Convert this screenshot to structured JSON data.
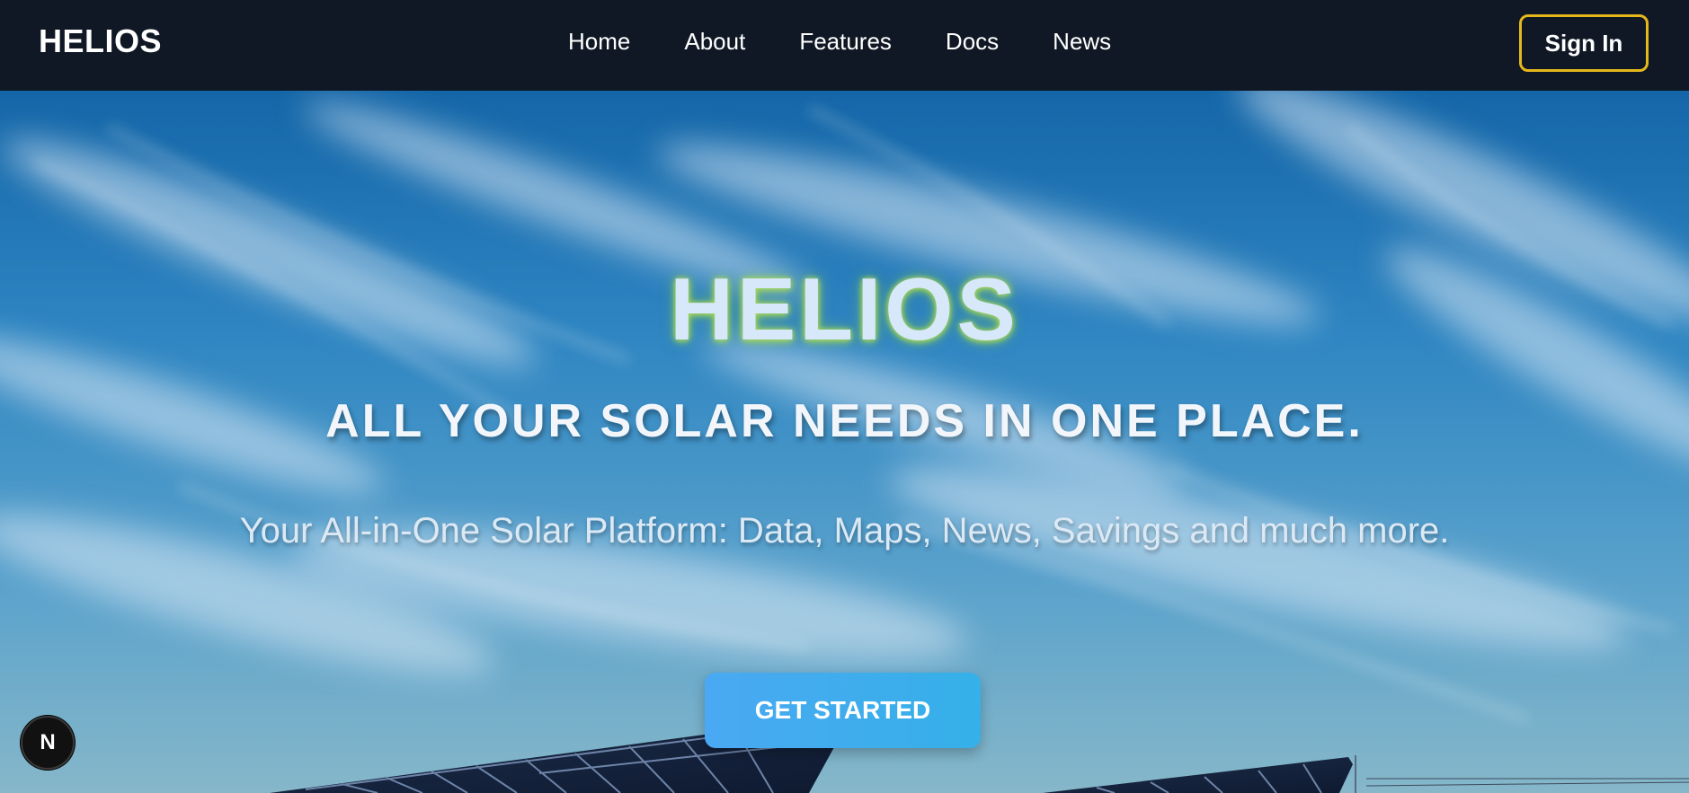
{
  "navbar": {
    "brand": "HELIOS",
    "links": [
      "Home",
      "About",
      "Features",
      "Docs",
      "News"
    ],
    "signin_label": "Sign In",
    "signin_border_color": "#e6b81c",
    "background": "#0f1824"
  },
  "hero": {
    "title": "HELIOS",
    "tagline": "ALL YOUR SOLAR NEEDS IN ONE PLACE.",
    "subtitle": "Your All-in-One Solar Platform: Data, Maps, News, Savings and much more.",
    "cta_label": "GET STARTED",
    "cta_color": "#4aa9f2",
    "background_image": "blue sky with wispy clouds over solar panels"
  },
  "devtools_badge": {
    "label": "N",
    "icon": "nextjs-icon"
  }
}
